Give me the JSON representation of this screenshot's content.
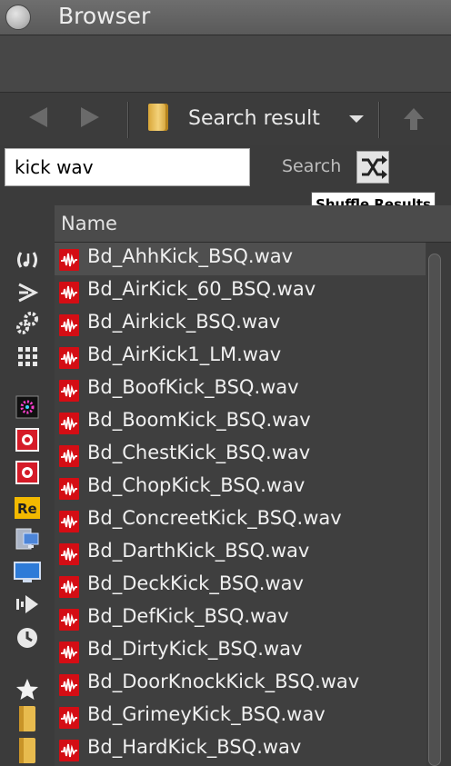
{
  "window": {
    "title": "Browser"
  },
  "toolbar": {
    "location_label": "Search result"
  },
  "search": {
    "query": "kick wav",
    "button_label": "Search",
    "shuffle_tooltip": "Shuffle Results"
  },
  "list": {
    "column_header": "Name",
    "files": [
      "Bd_AhhKick_BSQ.wav",
      "Bd_AirKick_60_BSQ.wav",
      "Bd_Airkick_BSQ.wav",
      "Bd_AirKick1_LM.wav",
      "Bd_BoofKick_BSQ.wav",
      "Bd_BoomKick_BSQ.wav",
      "Bd_ChestKick_BSQ.wav",
      "Bd_ChopKick_BSQ.wav",
      "Bd_ConcreetKick_BSQ.wav",
      "Bd_DarthKick_BSQ.wav",
      "Bd_DeckKick_BSQ.wav",
      "Bd_DefKick_BSQ.wav",
      "Bd_DirtyKick_BSQ.wav",
      "Bd_DoorKnockKick_BSQ.wav",
      "Bd_GrimeyKick_BSQ.wav",
      "Bd_HardKick_BSQ.wav"
    ],
    "selected_index": 0
  },
  "sidebar": {
    "icons": [
      "audio-clip-icon",
      "send-icon",
      "gears-icon",
      "grid-dots-icon",
      "effect-rack-icon",
      "rack-module-icon",
      "rack-module-icon",
      "rewire-icon",
      "computer-icon",
      "monitor-icon",
      "flow-icon",
      "clock-icon",
      "star-icon",
      "folder-icon",
      "folder-icon"
    ],
    "rewire_badge": "Re"
  },
  "colors": {
    "accent_file": "#d40d14",
    "background": "#3b3b3b"
  }
}
